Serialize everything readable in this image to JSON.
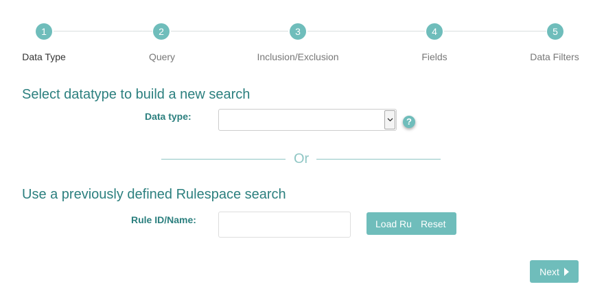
{
  "stepper": {
    "steps": [
      {
        "number": "1",
        "label": "Data Type"
      },
      {
        "number": "2",
        "label": "Query"
      },
      {
        "number": "3",
        "label": "Inclusion/Exclusion"
      },
      {
        "number": "4",
        "label": "Fields"
      },
      {
        "number": "5",
        "label": "Data Filters"
      }
    ],
    "active_step": 1
  },
  "datatype_section": {
    "title": "Select datatype to build a new search",
    "field_label": "Data type:",
    "selected_value": "",
    "help_icon": "?"
  },
  "divider": {
    "text": "Or"
  },
  "rulespace_section": {
    "title": "Use a previously defined Rulespace search",
    "field_label": "Rule ID/Name:",
    "input_value": "",
    "load_label": "Load Ru",
    "reset_label": "Reset"
  },
  "footer": {
    "next_label": "Next"
  },
  "colors": {
    "accent": "#6fbdbb",
    "heading": "#2b7f7e",
    "divider": "#8fc6c4"
  },
  "icons": {
    "help": "question-circle-icon",
    "next": "caret-right-icon",
    "select": "chevron-down-icon"
  }
}
